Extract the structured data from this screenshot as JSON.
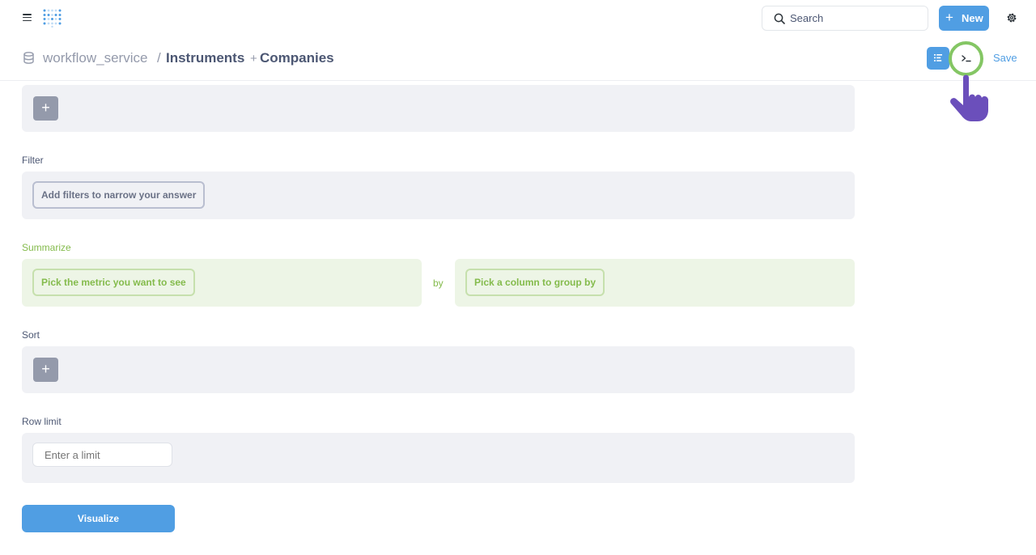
{
  "nav": {
    "search_label": "Search",
    "new_label": "New"
  },
  "breadcrumb": {
    "database": "workflow_service",
    "separator": "/",
    "table": "Instruments",
    "join_prefix": "+",
    "joined_table": "Companies"
  },
  "header_actions": {
    "save_label": "Save"
  },
  "steps": {
    "filter": {
      "label": "Filter",
      "placeholder": "Add filters to narrow your answer"
    },
    "summarize": {
      "label": "Summarize",
      "metric_placeholder": "Pick the metric you want to see",
      "by_label": "by",
      "group_placeholder": "Pick a column to group by"
    },
    "sort": {
      "label": "Sort"
    },
    "row_limit": {
      "label": "Row limit",
      "placeholder": "Enter a limit"
    }
  },
  "visualize_label": "Visualize",
  "colors": {
    "brand": "#509ee3",
    "summarize_green": "#84bb4c",
    "highlight_ring": "#84c664",
    "pointer_hand": "#6b4fbb",
    "step_bg": "#f0f1f5"
  },
  "icons": {
    "menu": "hamburger-icon",
    "logo": "metabase-logo",
    "search": "search-icon",
    "new": "plus-icon",
    "settings": "gear-icon",
    "database": "database-icon",
    "notebook": "notebook-icon",
    "sql": "terminal-icon",
    "pointer": "pointing-hand-icon"
  }
}
